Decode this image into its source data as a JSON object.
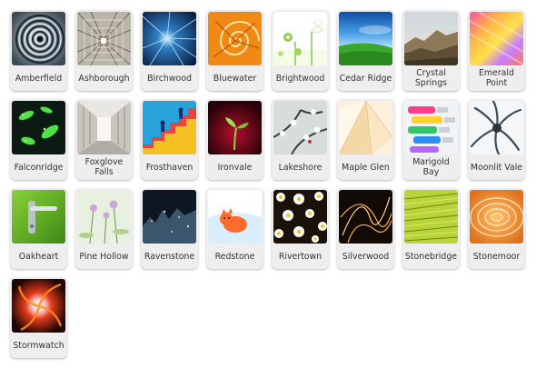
{
  "themes": [
    {
      "name": "Amberfield",
      "image": "concentric-rings-image"
    },
    {
      "name": "Ashborough",
      "image": "tunnel-image"
    },
    {
      "name": "Birchwood",
      "image": "light-rays-image"
    },
    {
      "name": "Bluewater",
      "image": "nautilus-shell-image"
    },
    {
      "name": "Brightwood",
      "image": "white-flowers-image"
    },
    {
      "name": "Cedar Ridge",
      "image": "green-field-image"
    },
    {
      "name": "Crystal Springs",
      "image": "rocky-landscape-image"
    },
    {
      "name": "Emerald Point",
      "image": "colored-pencils-image"
    },
    {
      "name": "Falconridge",
      "image": "green-bugs-image"
    },
    {
      "name": "Foxglove Falls",
      "image": "corridor-image"
    },
    {
      "name": "Frosthaven",
      "image": "staircase-climbers-image"
    },
    {
      "name": "Ironvale",
      "image": "sprout-image"
    },
    {
      "name": "Lakeshore",
      "image": "frosted-branches-image"
    },
    {
      "name": "Maple Glen",
      "image": "paper-folds-image"
    },
    {
      "name": "Marigold Bay",
      "image": "paint-tubes-image"
    },
    {
      "name": "Moonlit Vale",
      "image": "metal-tendrils-image"
    },
    {
      "name": "Oakheart",
      "image": "door-handle-image"
    },
    {
      "name": "Pine Hollow",
      "image": "wildflowers-image"
    },
    {
      "name": "Ravenstone",
      "image": "dark-texture-image"
    },
    {
      "name": "Redstone",
      "image": "orange-cat-image"
    },
    {
      "name": "Rivertown",
      "image": "daisy-pattern-image"
    },
    {
      "name": "Silverwood",
      "image": "light-streaks-image"
    },
    {
      "name": "Stonebridge",
      "image": "green-grass-texture-image"
    },
    {
      "name": "Stonemoor",
      "image": "orange-ripples-image"
    },
    {
      "name": "Stormwatch",
      "image": "fire-swirl-image"
    }
  ]
}
